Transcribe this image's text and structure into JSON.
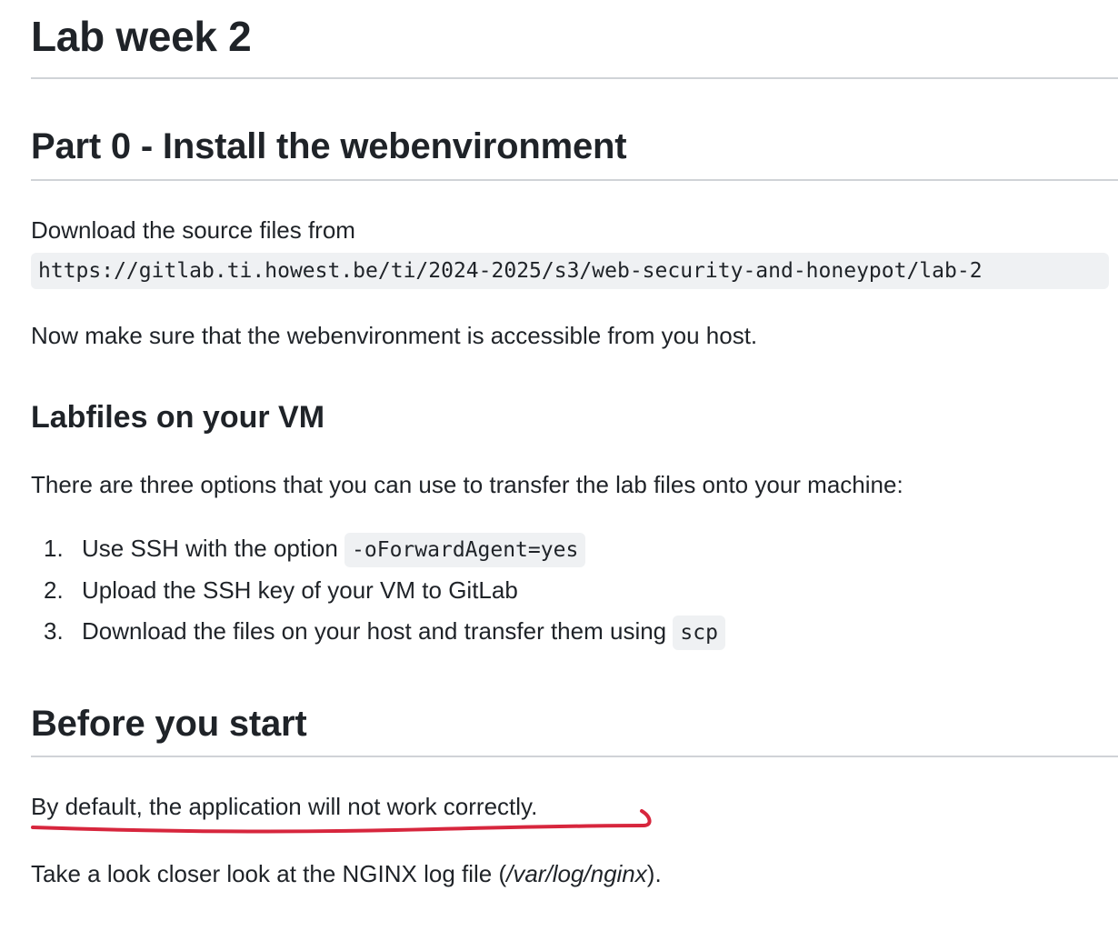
{
  "title": "Lab week 2",
  "part0": {
    "heading": "Part 0 - Install the webenvironment",
    "download_text": "Download the source files from",
    "source_url": "https://gitlab.ti.howest.be/ti/2024-2025/s3/web-security-and-honeypot/lab-2",
    "accessible_text": "Now make sure that the webenvironment is accessible from you host."
  },
  "labfiles": {
    "heading": "Labfiles on your VM",
    "intro": "There are three options that you can use to transfer the lab files onto your machine:",
    "options": [
      {
        "number": "1.",
        "text": "Use SSH with the option",
        "code": "-oForwardAgent=yes"
      },
      {
        "number": "2.",
        "text": "Upload the SSH key of your VM to GitLab",
        "code": ""
      },
      {
        "number": "3.",
        "text": "Download the files on your host and transfer them using",
        "code": "scp"
      }
    ]
  },
  "before": {
    "heading": "Before you start",
    "warning": "By default, the application will not work correctly.",
    "look_prefix": "Take a look closer look at the NGINX log file (",
    "log_path": "/var/log/nginx",
    "look_suffix": ")."
  },
  "annotation": {
    "underline_color": "#d7263d"
  }
}
